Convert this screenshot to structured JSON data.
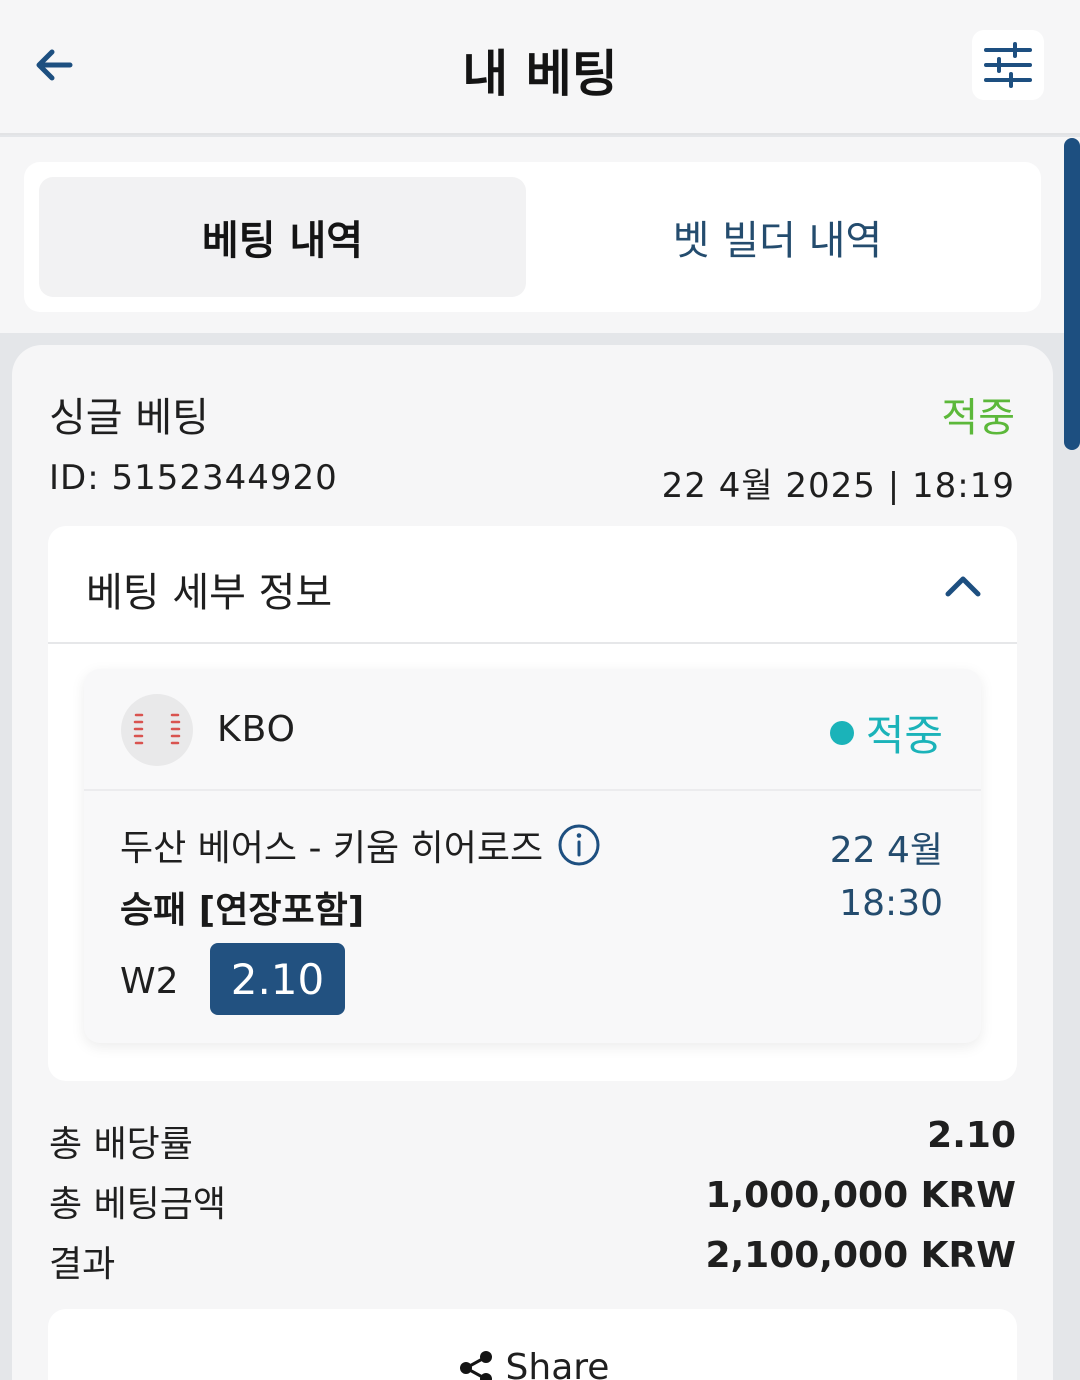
{
  "header": {
    "title": "내 베팅",
    "back_icon": "arrow-left-icon",
    "filter_icon": "sliders-icon"
  },
  "tabs": [
    {
      "label": "베팅 내역",
      "active": true
    },
    {
      "label": "벳 빌더 내역",
      "active": false
    }
  ],
  "bet": {
    "type": "싱글 베팅",
    "status": "적중",
    "id": "ID: 5152344920",
    "datetime": "22 4월 2025 | 18:19",
    "details": {
      "title": "베팅 세부 정보",
      "event": {
        "league": "KBO",
        "status": "적중",
        "match": "두산 베어스 - 키움 히어로즈",
        "date": "22 4월",
        "time": "18:30",
        "market": "승패 [연장포함]",
        "selection": "W2",
        "odds": "2.10"
      }
    },
    "summary": [
      {
        "label": "총 배당률",
        "value": "2.10"
      },
      {
        "label": "총 베팅금액",
        "value": "1,000,000 KRW"
      },
      {
        "label": "결과",
        "value": "2,100,000 KRW"
      }
    ],
    "share_label": "Share"
  },
  "colors": {
    "accent": "#244c6e",
    "win_green": "#5cb83a",
    "teal": "#1bb3b9",
    "odds_bg": "#225180"
  }
}
